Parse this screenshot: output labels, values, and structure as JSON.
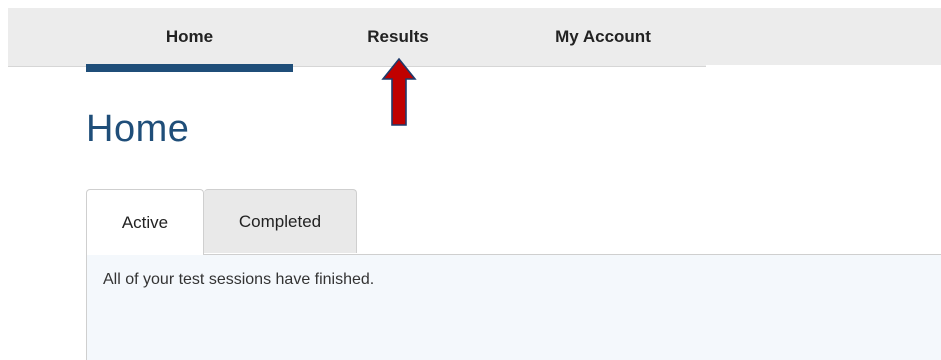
{
  "nav": {
    "items": [
      {
        "label": "Home",
        "active": true
      },
      {
        "label": "Results",
        "active": false
      },
      {
        "label": "My Account",
        "active": false
      }
    ]
  },
  "annotation": {
    "icon": "up-arrow-icon",
    "color": "#c00000"
  },
  "main": {
    "title": "Home",
    "tabs": [
      {
        "label": "Active",
        "selected": true
      },
      {
        "label": "Completed",
        "selected": false
      }
    ],
    "message": "All of your test sessions have finished."
  },
  "colors": {
    "accent": "#1f4e79",
    "nav_background": "#ececec",
    "panel_background": "#f4f8fc"
  }
}
